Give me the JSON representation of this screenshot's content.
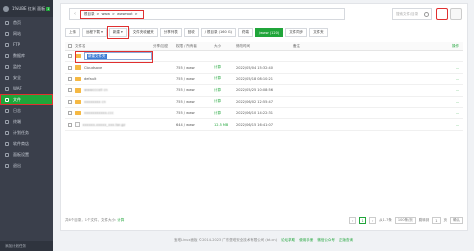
{
  "sidebar": {
    "brand": "1%UBE 红米 面板",
    "brand_tag": "1",
    "items": [
      {
        "label": "首页"
      },
      {
        "label": "网站"
      },
      {
        "label": "FTP"
      },
      {
        "label": "数据库"
      },
      {
        "label": "监控"
      },
      {
        "label": "安全"
      },
      {
        "label": "WAF"
      },
      {
        "label": "文件"
      },
      {
        "label": "日志"
      },
      {
        "label": "终端"
      },
      {
        "label": "计划任务"
      },
      {
        "label": "软件商店"
      },
      {
        "label": "面板设置"
      },
      {
        "label": "退出"
      }
    ],
    "footer": "添加计划任务"
  },
  "path": {
    "back": "‹",
    "crumbs": [
      "根目录",
      ">",
      "www",
      ">",
      "wwwroot",
      ">"
    ]
  },
  "search": {
    "placeholder": "搜索文件/目录"
  },
  "toolbar": {
    "upload": "上传",
    "remote_download": "远程下载 ▾",
    "new": "新建 ▾",
    "favorites": "文件夹收藏夹",
    "share_list": "分享列表",
    "recycle": "回收",
    "disk": "/ 根目录 (160 G)",
    "terminal": "终端",
    "www_badge": "/www (120)",
    "sync": "文件同步",
    "extra": "文件夹"
  },
  "table": {
    "headers": {
      "name": "文件名",
      "share": "分享/加密",
      "perm": "权限 / 所有者",
      "size": "大小",
      "time": "修改时间",
      "note": "备注",
      "ops": "操作"
    },
    "new_input_value": "新建文件夹",
    "rows": [
      {
        "type": "folder",
        "name": "Cloudsave",
        "share": "",
        "perm": "755 / www",
        "size": "计算",
        "time": "2022/05/04 15:32:40",
        "note": "",
        "ops": "..."
      },
      {
        "type": "folder",
        "name": "default",
        "share": "",
        "perm": "755 / www",
        "size": "计算",
        "time": "2022/05/18 08:10:21",
        "note": "",
        "ops": "..."
      },
      {
        "type": "folder",
        "name": "wwwcccell cn",
        "share": "",
        "perm": "755 / www",
        "size": "计算",
        "time": "2022/05/25 10:08:56",
        "note": "",
        "ops": "..."
      },
      {
        "type": "folder",
        "name": "xxxxxxxx cn",
        "share": "",
        "perm": "755 / www",
        "size": "计算",
        "time": "2022/06/02 12:55:47",
        "note": "",
        "ops": "..."
      },
      {
        "type": "folder",
        "name": "xxxxxxxxxxx.ccc",
        "share": "",
        "perm": "755 / www",
        "size": "计算",
        "time": "2022/06/10 14:22:31",
        "note": "",
        "ops": "..."
      },
      {
        "type": "file",
        "name": "xxxxxx.xxxxx_xxx.tar.gz",
        "share": "",
        "perm": "644 / www",
        "size": "12.5 MB",
        "time": "2022/06/15 16:41:07",
        "note": "",
        "ops": "..."
      }
    ]
  },
  "footer": {
    "stat_prefix": "共6个目录，1个文件，文件大小:",
    "stat_link": "计算",
    "page_current": "1",
    "page_info": "从1-7条",
    "per_page": "100条/页",
    "goto_label": "跳转到",
    "goto_value": "1",
    "goto_unit": "页",
    "confirm": "确认"
  },
  "copyright": {
    "text": "宝塔Linux面板 ©2014-2023 广东堡塔安全技术有限公司 (bt.cn)",
    "links": [
      "论坛求助",
      "使用手册",
      "微信公众号",
      "正版查询"
    ]
  },
  "colors": {
    "accent": "#20a53a",
    "highlight": "#e03030",
    "sidebar": "#3a3f4b"
  }
}
